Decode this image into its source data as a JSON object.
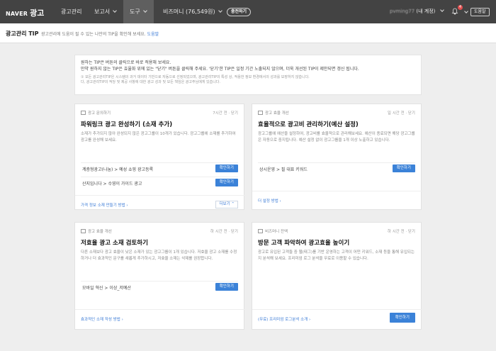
{
  "nav": {
    "logo_naver": "NAVER",
    "logo_ad": "광고",
    "items": [
      "광고관리",
      "보고서",
      "도구"
    ],
    "bizmoney": "비즈머니 (76,549원)",
    "charge_label": "충전하기",
    "account_blur": "pvming77",
    "account_suffix": "(내 계정)",
    "alarm_count": "4",
    "help_label": "도움말"
  },
  "subheader": {
    "title": "광고관리 TIP",
    "desc": "광고관리에 도움이 될 수 있는 나만의 TIP을 확인해 보세요.",
    "link": "도움말"
  },
  "notice": {
    "line1": "원하는 TIP은 버튼의 클릭으로 바로 적용해 보세요.",
    "line2": "만약 원하지 않는 TIP은 효율화 위에 있는 \"닫기\" 버튼을 클릭해 주세요. '닫기'한 TIP은 일정 기간 노출되지 않으며, 더욱 개선된 TIP이 제안되면 갱신 됩니다.",
    "small1": "① 모든 광고관리TIP은 시스템의 과거 데이터 기반으로 자동으로 선정되었으며, 광고관리TIP의 특성 상, 적용한 정보 환경에서의 성과를 보장하지 않습니다.",
    "small2": "다, 광고관리TIP의 적당 및 제공 사항에 대한 광고 성과 및 모든 책임은 광고주님에게 있습니다."
  },
  "cards": {
    "c1": {
      "category": "광고 문의하기",
      "meta": "7시간 전 · 닫기",
      "title": "파워링크 광고 완성하기 (소재 추가)",
      "desc": "소재가 추가되지 않아 완성되지 않은 광고그룹이 10개가 있습니다. 광고그룹에 소재를 추가하여 광고를 완성해 보세요.",
      "row1": "계층형광고(나눔) > 예성 쇼핑 광고등록",
      "row2": "산지입니다 > 수영이 가이드 광고",
      "btn": "확인하기",
      "foot_link": "가격 정보 소재 만들기 방법",
      "more": "더보기"
    },
    "c2": {
      "category": "광고 효율 개선",
      "meta": "일 시간 전 · 닫기",
      "title": "효율적으로 광고비 관리하기(예산 설정)",
      "desc": "광고그룹에 예산을 설정하여, 광고비를 효율적으로 관리해보세요. 예산이 종료되면 해당 광고그룹은 자동으로 중지됩니다. 예산 설정 없이 광고그룹을 1개 이상 노출하고 있습니다.",
      "row1": "상시운영 > 필 대표 키워드",
      "btn": "확인하기",
      "foot_link": "더 설정 방법"
    },
    "c3": {
      "category": "광고 효율 개선",
      "meta": "하 시간 전 · 닫기",
      "title": "저효율 광고 소재 검토하기",
      "desc": "다른 소재보다 광고 효율이 낮은 소재가 있는 광고그룹이 1개 있습니다. 저효율 광고 소재를 수정하거나 더 효과적인 문구를 새롭게 추가하시고, 저효율 소재는 삭제를 권장합니다.",
      "row1": "모바일 혁신 > 이상_저예산",
      "btn": "확인하기",
      "foot_link": "효과적인 소재 작성 방법"
    },
    "c4": {
      "category": "비즈머니 잔액",
      "meta": "하 시간 전 · 닫기",
      "title": "방문 고객 파악하여 광고효율 높이기",
      "desc": "광고로 유입된 고객들 중 웹(태그)를 기반 운영하는 고객이 어떤 키워드, 소재 등을 통해 유입되는지 분석해 보세요. 프리미엄 로그 분석을 무료로 이용할 수 있습니다.",
      "btn": "확인하기",
      "foot_link": "(무료) 프리미엄 로그분석 소개"
    }
  }
}
